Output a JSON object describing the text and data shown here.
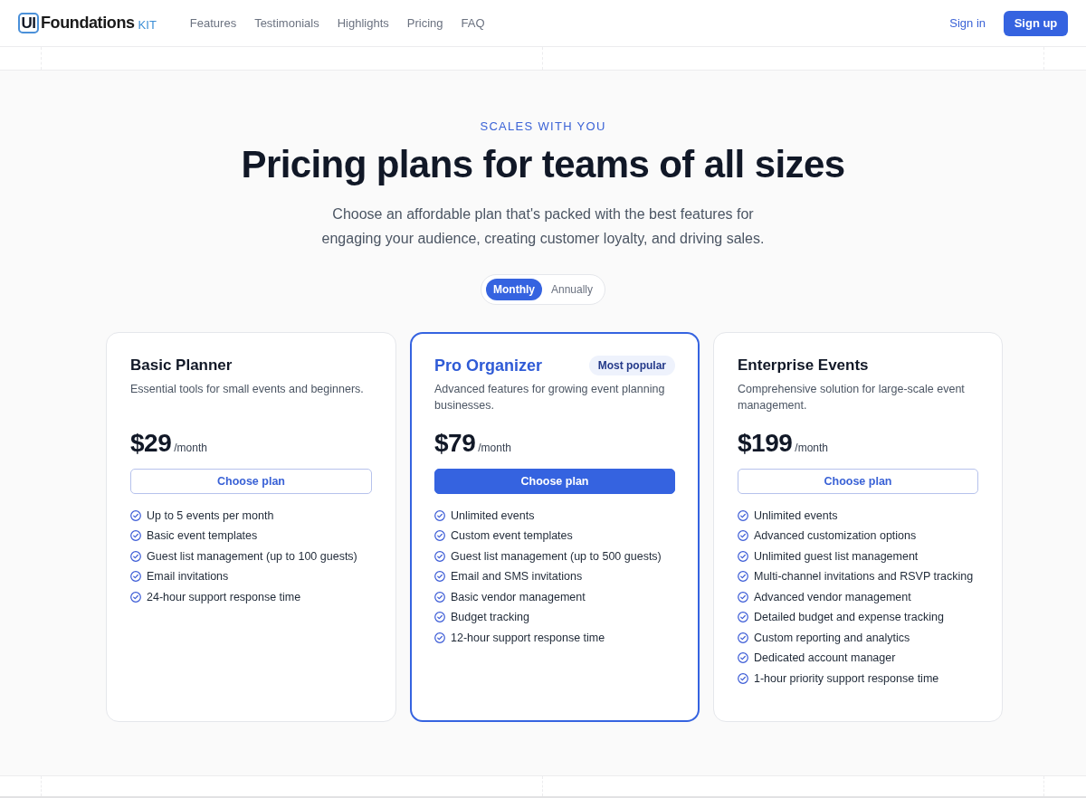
{
  "header": {
    "logo": {
      "mark": "UI",
      "name": "Foundations",
      "suffix": "KIT"
    },
    "nav": [
      {
        "label": "Features"
      },
      {
        "label": "Testimonials"
      },
      {
        "label": "Highlights"
      },
      {
        "label": "Pricing"
      },
      {
        "label": "FAQ"
      }
    ],
    "sign_in": "Sign in",
    "sign_up": "Sign up"
  },
  "pricing": {
    "eyebrow": "SCALES WITH YOU",
    "title": "Pricing plans for teams of all sizes",
    "description": "Choose an affordable plan that's packed with the best features for engaging your audience, creating customer loyalty, and driving sales.",
    "billing_toggle": [
      {
        "label": "Monthly",
        "selected": true
      },
      {
        "label": "Annually",
        "selected": false
      }
    ],
    "plans": [
      {
        "name": "Basic Planner",
        "featured": false,
        "description": "Essential tools for small events and beginners.",
        "price": "$29",
        "period": "/month",
        "button": "Choose plan",
        "features": [
          "Up to 5 events per month",
          "Basic event templates",
          "Guest list management (up to 100 guests)",
          "Email invitations",
          "24-hour support response time"
        ]
      },
      {
        "name": "Pro Organizer",
        "featured": true,
        "badge": "Most popular",
        "description": "Advanced features for growing event planning businesses.",
        "price": "$79",
        "period": "/month",
        "button": "Choose plan",
        "features": [
          "Unlimited events",
          "Custom event templates",
          "Guest list management (up to 500 guests)",
          "Email and SMS invitations",
          "Basic vendor management",
          "Budget tracking",
          "12-hour support response time"
        ]
      },
      {
        "name": "Enterprise Events",
        "featured": false,
        "description": "Comprehensive solution for large-scale event management.",
        "price": "$199",
        "period": "/month",
        "button": "Choose plan",
        "features": [
          "Unlimited events",
          "Advanced customization options",
          "Unlimited guest list management",
          "Multi-channel invitations and RSVP tracking",
          "Advanced vendor management",
          "Detailed budget and expense tracking",
          "Custom reporting and analytics",
          "Dedicated account manager",
          "1-hour priority support response time"
        ]
      }
    ]
  }
}
